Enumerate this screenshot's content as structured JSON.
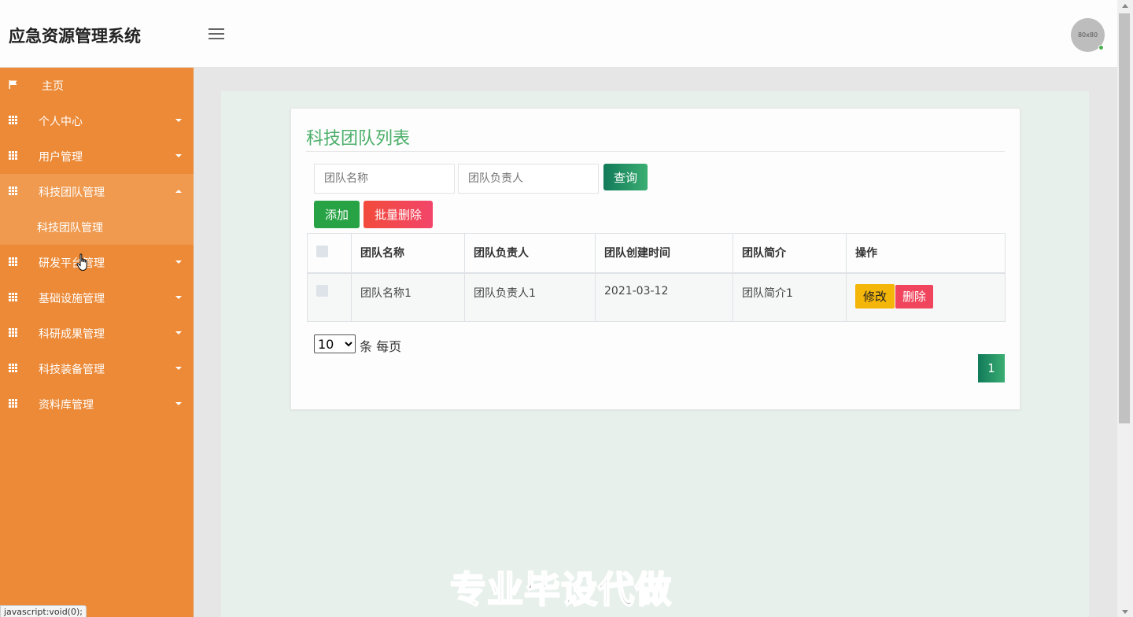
{
  "header": {
    "app_title": "应急资源管理系统",
    "avatar_text": "80x80"
  },
  "sidebar": {
    "items": [
      {
        "label": "主页",
        "icon": "flag-icon"
      },
      {
        "label": "个人中心",
        "icon": "grid-icon"
      },
      {
        "label": "用户管理",
        "icon": "grid-icon"
      },
      {
        "label": "科技团队管理",
        "icon": "grid-icon",
        "expanded": true
      },
      {
        "label": "研发平台管理",
        "icon": "grid-icon"
      },
      {
        "label": "基础设施管理",
        "icon": "grid-icon"
      },
      {
        "label": "科研成果管理",
        "icon": "grid-icon"
      },
      {
        "label": "科技装备管理",
        "icon": "grid-icon"
      },
      {
        "label": "资料库管理",
        "icon": "grid-icon"
      }
    ],
    "sub_item": "科技团队管理",
    "sidebar_color": "#ec8a37"
  },
  "status_tip": "javascript:void(0);",
  "main": {
    "title": "科技团队列表",
    "search": {
      "team_name_placeholder": "团队名称",
      "leader_placeholder": "团队负责人",
      "query_label": "查询"
    },
    "actions": {
      "add_label": "添加",
      "batch_delete_label": "批量删除"
    },
    "table": {
      "columns": [
        "团队名称",
        "团队负责人",
        "团队创建时间",
        "团队简介",
        "操作"
      ],
      "rows": [
        {
          "name": "团队名称1",
          "leader": "团队负责人1",
          "created": "2021-03-12",
          "intro": "团队简介1"
        }
      ],
      "edit_label": "修改",
      "delete_label": "删除"
    },
    "pagination": {
      "page_size": "10",
      "page_size_suffix": "条 每页",
      "current_page": "1"
    }
  },
  "watermark": "专业毕设代做"
}
